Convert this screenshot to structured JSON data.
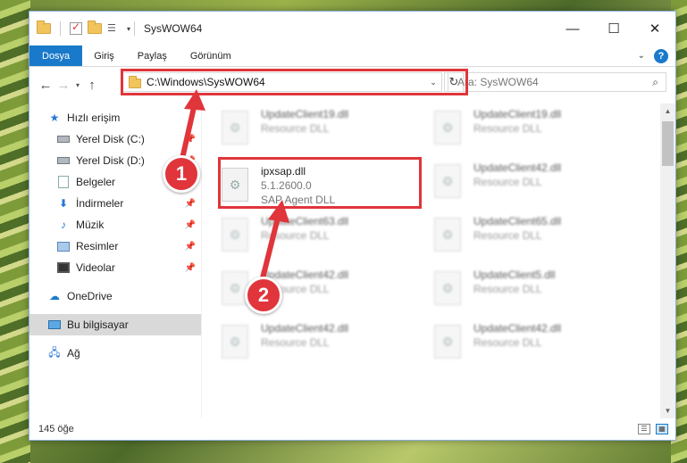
{
  "window": {
    "title": "SysWOW64"
  },
  "ribbon": {
    "tabs": [
      {
        "label": "Dosya",
        "active": true
      },
      {
        "label": "Giriş",
        "active": false
      },
      {
        "label": "Paylaş",
        "active": false
      },
      {
        "label": "Görünüm",
        "active": false
      }
    ]
  },
  "navbar": {
    "address": "C:\\Windows\\SysWOW64",
    "search_placeholder": "Ara: SysWOW64"
  },
  "sidebar": {
    "items": [
      {
        "label": "Hızlı erişim",
        "icon": "star-icon",
        "level": 0,
        "pinned": false
      },
      {
        "label": "Yerel Disk (C:)",
        "icon": "disk-icon",
        "level": 1,
        "pinned": true
      },
      {
        "label": "Yerel Disk (D:)",
        "icon": "disk-icon",
        "level": 1,
        "pinned": true
      },
      {
        "label": "Belgeler",
        "icon": "document-icon",
        "level": 1,
        "pinned": true
      },
      {
        "label": "İndirmeler",
        "icon": "download-icon",
        "level": 1,
        "pinned": true
      },
      {
        "label": "Müzik",
        "icon": "music-icon",
        "level": 1,
        "pinned": true
      },
      {
        "label": "Resimler",
        "icon": "pictures-icon",
        "level": 1,
        "pinned": true
      },
      {
        "label": "Videolar",
        "icon": "video-icon",
        "level": 1,
        "pinned": true
      },
      {
        "label": "OneDrive",
        "icon": "cloud-icon",
        "level": 0,
        "pinned": false
      },
      {
        "label": "Bu bilgisayar",
        "icon": "computer-icon",
        "level": 0,
        "pinned": false,
        "selected": true
      },
      {
        "label": "Ağ",
        "icon": "network-icon",
        "level": 0,
        "pinned": false
      }
    ]
  },
  "files": {
    "col1": [
      {
        "name": "UpdateClient19.dll",
        "meta1": "Resource DLL",
        "meta2": ""
      },
      {
        "name": "ipxsap.dll",
        "meta1": "5.1.2600.0",
        "meta2": "SAP Agent DLL"
      },
      {
        "name": "UpdateClient63.dll",
        "meta1": "Resource DLL",
        "meta2": ""
      },
      {
        "name": "UpdateClient42.dll",
        "meta1": "Resource DLL",
        "meta2": ""
      },
      {
        "name": "UpdateClient42.dll",
        "meta1": "Resource DLL",
        "meta2": ""
      }
    ],
    "col2": [
      {
        "name": "UpdateClient19.dll",
        "meta1": "Resource DLL"
      },
      {
        "name": "UpdateClient42.dll",
        "meta1": "Resource DLL"
      },
      {
        "name": "UpdateClient65.dll",
        "meta1": "Resource DLL"
      },
      {
        "name": "UpdateClient5.dll",
        "meta1": "Resource DLL"
      },
      {
        "name": "UpdateClient42.dll",
        "meta1": "Resource DLL"
      }
    ]
  },
  "status": {
    "count": "145 öğe"
  },
  "annotations": {
    "badge1": "1",
    "badge2": "2"
  },
  "colors": {
    "accent": "#1979ca",
    "highlight": "#e0353b"
  }
}
